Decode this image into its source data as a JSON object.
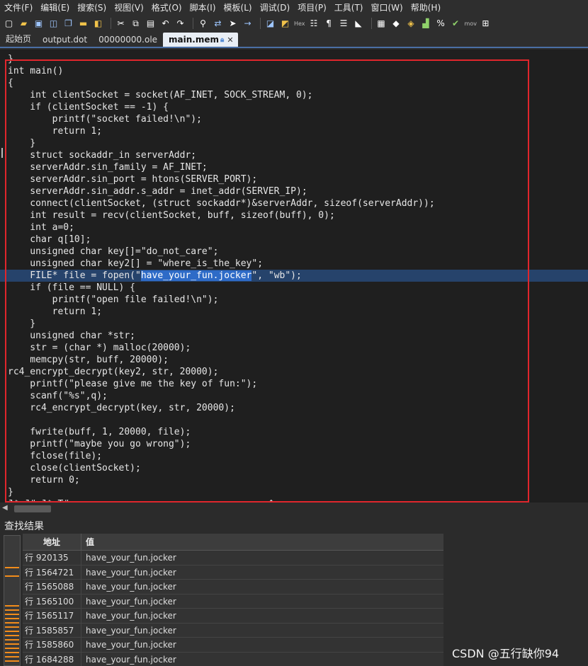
{
  "menu": [
    "文件(F)",
    "编辑(E)",
    "搜索(S)",
    "视图(V)",
    "格式(O)",
    "脚本(I)",
    "模板(L)",
    "调试(D)",
    "项目(P)",
    "工具(T)",
    "窗口(W)",
    "帮助(H)"
  ],
  "toolbar": {
    "icons": [
      "new-file-icon",
      "open-icon",
      "save-icon",
      "save-all-icon",
      "copy-file-icon",
      "folder-icon",
      "archive-icon",
      "cut-icon",
      "copy-icon",
      "paste-icon",
      "undo-icon",
      "redo-icon",
      "find-icon",
      "replace-icon",
      "goto-icon",
      "next-icon",
      "bookmark-icon",
      "hex-icon",
      "compare-icon",
      "pilcrow-icon",
      "columns-icon",
      "highlight-icon",
      "calculator-icon",
      "script-icon",
      "template-icon",
      "histogram-icon",
      "percent-icon",
      "checksum-icon",
      "mov-icon",
      "base-convert-icon"
    ],
    "hex_label": "Hex",
    "mov_label": "mov"
  },
  "tabs": [
    {
      "label": "起始页",
      "active": false
    },
    {
      "label": "output.dot",
      "active": false
    },
    {
      "label": "00000000.ole",
      "active": false
    },
    {
      "label": "main.mem",
      "active": true
    }
  ],
  "editor": {
    "current_line_index": 18,
    "selection": "have_your_fun.jocker",
    "lines": [
      "}",
      "int main()",
      "{",
      "    int clientSocket = socket(AF_INET, SOCK_STREAM, 0);",
      "    if (clientSocket == -1) {",
      "        printf(\"socket failed!\\n\");",
      "        return 1;",
      "    }",
      "    struct sockaddr_in serverAddr;",
      "    serverAddr.sin_family = AF_INET;",
      "    serverAddr.sin_port = htons(SERVER_PORT);",
      "    serverAddr.sin_addr.s_addr = inet_addr(SERVER_IP);",
      "    connect(clientSocket, (struct sockaddr*)&serverAddr, sizeof(serverAddr));",
      "    int result = recv(clientSocket, buff, sizeof(buff), 0);",
      "    int a=0;",
      "    char q[10];",
      "    unsigned char key[]=\"do_not_care\";",
      "    unsigned char key2[] = \"where_is_the_key\";",
      "    FILE* file = fopen(\"have_your_fun.jocker\", \"wb\");",
      "    if (file == NULL) {",
      "        printf(\"open file failed!\\n\");",
      "        return 1;",
      "    }",
      "    unsigned char *str;",
      "    str = (char *) malloc(20000);",
      "    memcpy(str, buff, 20000);",
      "rc4_encrypt_decrypt(key2, str, 20000);",
      "    printf(\"please give me the key of fun:\");",
      "    scanf(\"%s\",q);",
      "    rc4_encrypt_decrypt(key, str, 20000);",
      "",
      "    fwrite(buff, 1, 20000, file);",
      "    printf(\"maybe you go wrong\");",
      "    fclose(file);",
      "    close(clientSocket);",
      "    return 0;",
      "}",
      "J$ J# J$ T#                                    ^ "
    ]
  },
  "find_results": {
    "title": "查找结果",
    "columns": [
      "地址",
      "值"
    ],
    "rows": [
      {
        "address": "行 920135",
        "value": "have_your_fun.jocker"
      },
      {
        "address": "行 1564721",
        "value": "have_your_fun.jocker"
      },
      {
        "address": "行 1565088",
        "value": "have_your_fun.jocker"
      },
      {
        "address": "行 1565100",
        "value": "have_your_fun.jocker"
      },
      {
        "address": "行 1565117",
        "value": "have_your_fun.jocker"
      },
      {
        "address": "行 1585857",
        "value": "have_your_fun.jocker"
      },
      {
        "address": "行 1585860",
        "value": "have_your_fun.jocker"
      },
      {
        "address": "行 1684288",
        "value": "have_your_fun.jocker"
      }
    ]
  },
  "watermark": "CSDN @五行缺你94",
  "colors": {
    "highlight_box": "#e0262c",
    "current_line": "#26436b",
    "selection": "#2e6bc7",
    "marker": "#f28c1b"
  }
}
